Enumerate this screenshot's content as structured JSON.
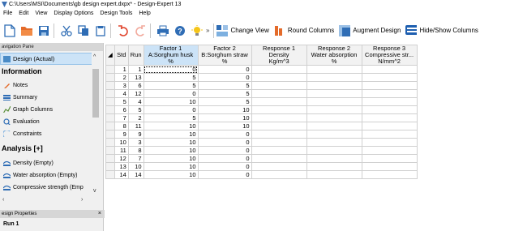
{
  "window": {
    "title": "C:\\Users\\MSI\\Documents\\gb design expert.dxpx* - Design-Expert 13"
  },
  "menu": [
    {
      "label": "File"
    },
    {
      "label": "Edit"
    },
    {
      "label": "View"
    },
    {
      "label": "Display Options"
    },
    {
      "label": "Design Tools"
    },
    {
      "label": "Help"
    }
  ],
  "toolbar": {
    "change_view": "Change View",
    "round_columns": "Round Columns",
    "augment_design": "Augment Design",
    "hide_show_columns": "Hide/Show Columns",
    "more": "»"
  },
  "nav": {
    "header": "avigation Pane",
    "design_actual": "Design (Actual)",
    "information_title": "Information",
    "info_items": [
      {
        "label": "Notes"
      },
      {
        "label": "Summary"
      },
      {
        "label": "Graph Columns"
      },
      {
        "label": "Evaluation"
      },
      {
        "label": "Constraints"
      }
    ],
    "analysis_title": "Analysis [+]",
    "analysis_items": [
      {
        "label": "Density (Empty)"
      },
      {
        "label": "Water absorption (Empty)"
      },
      {
        "label": "Compressive strength (Emp"
      }
    ],
    "properties_header": "esign Properties",
    "properties_close": "×",
    "run_label": "Run 1"
  },
  "grid": {
    "headers": [
      {
        "line1": "Std",
        "line2": "",
        "line3": ""
      },
      {
        "line1": "Run",
        "line2": "",
        "line3": ""
      },
      {
        "line1": "Factor 1",
        "line2": "A:Sorghum husk",
        "line3": "%"
      },
      {
        "line1": "Factor 2",
        "line2": "B:Sorghum straw",
        "line3": "%"
      },
      {
        "line1": "Response 1",
        "line2": "Density",
        "line3": "Kg/m^3"
      },
      {
        "line1": "Response 2",
        "line2": "Water absorption",
        "line3": "%"
      },
      {
        "line1": "Response 3",
        "line2": "Compressive str...",
        "line3": "N/mm^2"
      }
    ],
    "rows": [
      {
        "std": "1",
        "run": "1",
        "a": "0",
        "b": "0"
      },
      {
        "std": "2",
        "run": "13",
        "a": "5",
        "b": "0"
      },
      {
        "std": "3",
        "run": "6",
        "a": "5",
        "b": "5"
      },
      {
        "std": "4",
        "run": "12",
        "a": "0",
        "b": "5"
      },
      {
        "std": "5",
        "run": "4",
        "a": "10",
        "b": "5"
      },
      {
        "std": "6",
        "run": "5",
        "a": "0",
        "b": "10"
      },
      {
        "std": "7",
        "run": "2",
        "a": "5",
        "b": "10"
      },
      {
        "std": "8",
        "run": "11",
        "a": "10",
        "b": "10"
      },
      {
        "std": "9",
        "run": "9",
        "a": "10",
        "b": "0"
      },
      {
        "std": "10",
        "run": "3",
        "a": "10",
        "b": "0"
      },
      {
        "std": "11",
        "run": "8",
        "a": "10",
        "b": "0"
      },
      {
        "std": "12",
        "run": "7",
        "a": "10",
        "b": "0"
      },
      {
        "std": "13",
        "run": "10",
        "a": "10",
        "b": "0"
      },
      {
        "std": "14",
        "run": "14",
        "a": "10",
        "b": "0"
      }
    ]
  },
  "colors": {
    "accent": "#cce3f7",
    "toolbar_blue": "#2f6db5"
  }
}
